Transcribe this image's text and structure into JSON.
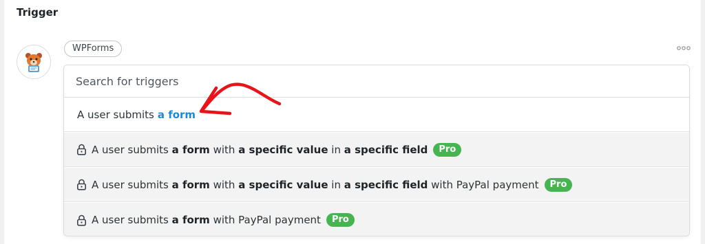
{
  "section": {
    "title": "Trigger"
  },
  "integration": {
    "name": "WPForms",
    "icon": "wpforms-bear-icon"
  },
  "menu": {
    "icon": "more-options-icon"
  },
  "search": {
    "placeholder": "Search for triggers"
  },
  "options": [
    {
      "prefix": "A user submits",
      "link": "a form",
      "locked": false,
      "annotated_with": "red-arrow-icon"
    },
    {
      "locked": true,
      "parts": [
        "A user submits ",
        "a form",
        " with ",
        "a specific value",
        " in ",
        "a specific field"
      ],
      "badge": "Pro"
    },
    {
      "locked": true,
      "parts": [
        "A user submits ",
        "a form",
        " with ",
        "a specific value",
        " in ",
        "a specific field",
        " with PayPal payment"
      ],
      "badge": "Pro"
    },
    {
      "locked": true,
      "parts": [
        "A user submits ",
        "a form",
        " with PayPal payment"
      ],
      "badge": "Pro"
    }
  ],
  "colors": {
    "link": "#1a8ad3",
    "pro_badge": "#46b450",
    "annotation_arrow": "#e8141a",
    "locked_row_bg": "#f3f3f4"
  }
}
